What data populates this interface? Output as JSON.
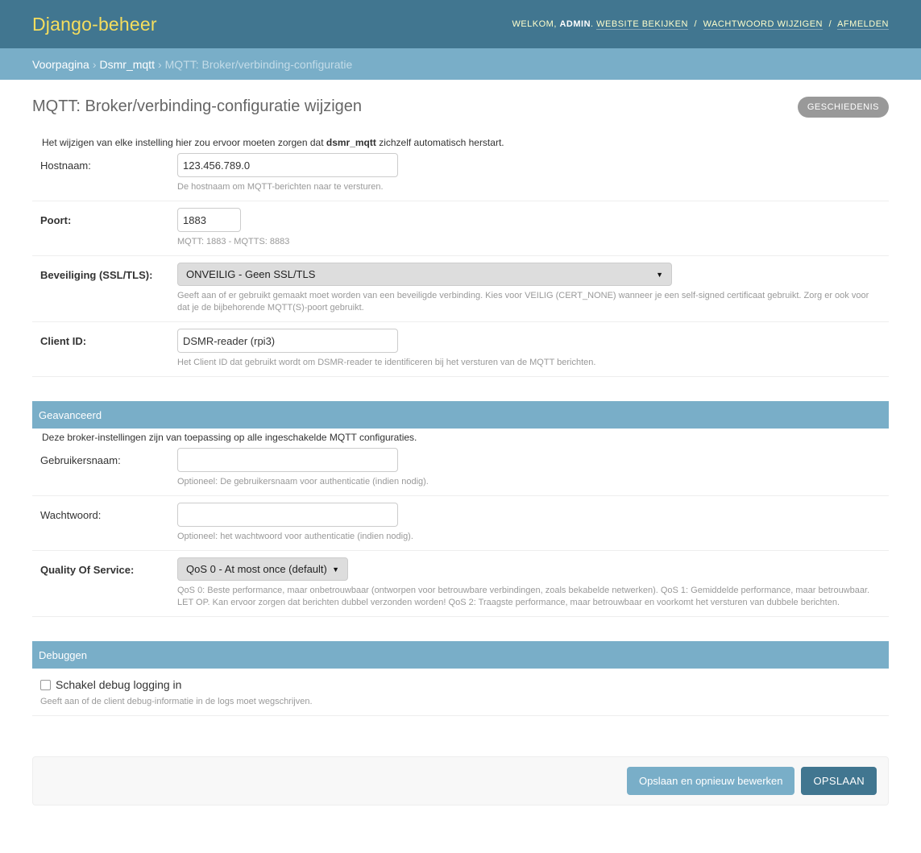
{
  "header": {
    "brand": "Django-beheer",
    "welcome": "Welkom,",
    "username": "admin",
    "links": [
      "Website bekijken",
      "Wachtwoord wijzigen",
      "Afmelden"
    ]
  },
  "breadcrumbs": {
    "home": "Voorpagina",
    "app": "Dsmr_mqtt",
    "current": "MQTT: Broker/verbinding-configuratie"
  },
  "page": {
    "title": "MQTT: Broker/verbinding-configuratie wijzigen",
    "history_label": "Geschiedenis"
  },
  "main": {
    "description_pre": "Het wijzigen van elke instelling hier zou ervoor moeten zorgen dat ",
    "description_bold": "dsmr_mqtt",
    "description_post": " zichzelf automatisch herstart.",
    "fields": {
      "hostname": {
        "label": "Hostnaam:",
        "value": "123.456.789.0",
        "help": "De hostnaam om MQTT-berichten naar te versturen."
      },
      "port": {
        "label": "Poort:",
        "value": "1883",
        "help": "MQTT: 1883 - MQTTS: 8883"
      },
      "security": {
        "label": "Beveiliging (SSL/TLS):",
        "value": "ONVEILIG - Geen SSL/TLS",
        "help": "Geeft aan of er gebruikt gemaakt moet worden van een beveiligde verbinding. Kies voor VEILIG (CERT_NONE) wanneer je een self-signed certificaat gebruikt. Zorg er ook voor dat je de bijbehorende MQTT(S)-poort gebruikt."
      },
      "client_id": {
        "label": "Client ID:",
        "value": "DSMR-reader (rpi3)",
        "help": "Het Client ID dat gebruikt wordt om DSMR-reader te identificeren bij het versturen van de MQTT berichten."
      }
    }
  },
  "advanced": {
    "title": "Geavanceerd",
    "description": "Deze broker-instellingen zijn van toepassing op alle ingeschakelde MQTT configuraties.",
    "fields": {
      "username": {
        "label": "Gebruikersnaam:",
        "value": "",
        "help": "Optioneel: De gebruikersnaam voor authenticatie (indien nodig)."
      },
      "password": {
        "label": "Wachtwoord:",
        "value": "",
        "help": "Optioneel: het wachtwoord voor authenticatie (indien nodig)."
      },
      "qos": {
        "label": "Quality Of Service:",
        "value": "QoS 0 - At most once (default)",
        "help": "QoS 0: Beste performance, maar onbetrouwbaar (ontworpen voor betrouwbare verbindingen, zoals bekabelde netwerken). QoS 1: Gemiddelde performance, maar betrouwbaar. LET OP. Kan ervoor zorgen dat berichten dubbel verzonden worden! QoS 2: Traagste performance, maar betrouwbaar en voorkomt het versturen van dubbele berichten."
      }
    }
  },
  "debug": {
    "title": "Debuggen",
    "checkbox_label": "Schakel debug logging in",
    "checked": false,
    "help": "Geeft aan of de client debug-informatie in de logs moet wegschrijven."
  },
  "submit": {
    "save_continue": "Opslaan en opnieuw bewerken",
    "save": "Opslaan"
  },
  "colors": {
    "header_bg": "#417690",
    "brand": "#f5dd5d",
    "breadcrumb_bg": "#79aec8",
    "fieldset_bg": "#79aec8",
    "primary_button": "#417690",
    "secondary_button": "#79aec8"
  }
}
